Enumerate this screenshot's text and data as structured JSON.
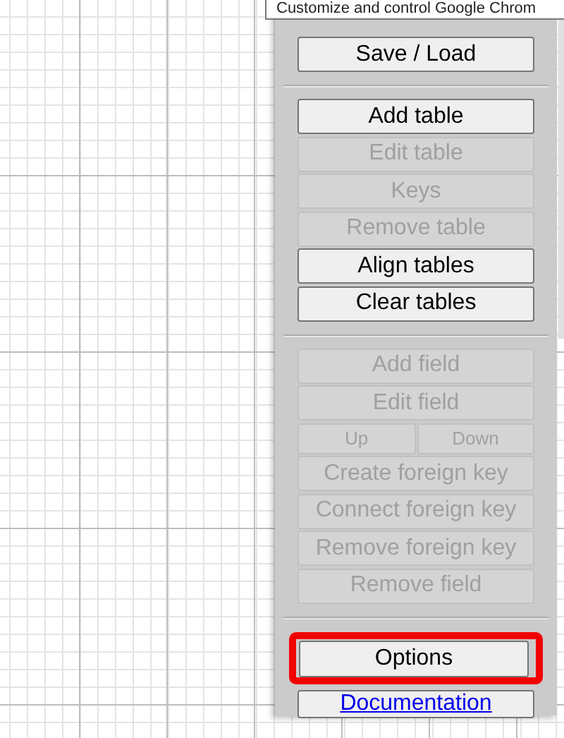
{
  "tooltip": "Customize and control Google Chrom",
  "groups": [
    {
      "items": [
        {
          "kind": "button",
          "label": "Save / Load",
          "disabled": false,
          "highlighted": false
        }
      ]
    },
    {
      "items": [
        {
          "kind": "button",
          "label": "Add table",
          "disabled": false,
          "highlighted": false
        },
        {
          "kind": "button",
          "label": "Edit table",
          "disabled": true,
          "highlighted": false
        },
        {
          "kind": "button",
          "label": "Keys",
          "disabled": true,
          "highlighted": false
        },
        {
          "kind": "button",
          "label": "Remove table",
          "disabled": true,
          "highlighted": false
        },
        {
          "kind": "button",
          "label": "Align tables",
          "disabled": false,
          "highlighted": false
        },
        {
          "kind": "button",
          "label": "Clear tables",
          "disabled": false,
          "highlighted": false
        }
      ]
    },
    {
      "items": [
        {
          "kind": "button",
          "label": "Add field",
          "disabled": true,
          "highlighted": false
        },
        {
          "kind": "button",
          "label": "Edit field",
          "disabled": true,
          "highlighted": false
        },
        {
          "kind": "pair",
          "buttons": [
            {
              "label": "Up",
              "disabled": true
            },
            {
              "label": "Down",
              "disabled": true
            }
          ]
        },
        {
          "kind": "button",
          "label": "Create foreign key",
          "disabled": true,
          "highlighted": false
        },
        {
          "kind": "button",
          "label": "Connect foreign key",
          "disabled": true,
          "highlighted": false
        },
        {
          "kind": "button",
          "label": "Remove foreign key",
          "disabled": true,
          "highlighted": false
        },
        {
          "kind": "button",
          "label": "Remove field",
          "disabled": true,
          "highlighted": false
        }
      ]
    },
    {
      "items": [
        {
          "kind": "button",
          "label": "Options",
          "disabled": false,
          "highlighted": true
        },
        {
          "kind": "link",
          "label": "Documentation"
        }
      ]
    }
  ]
}
